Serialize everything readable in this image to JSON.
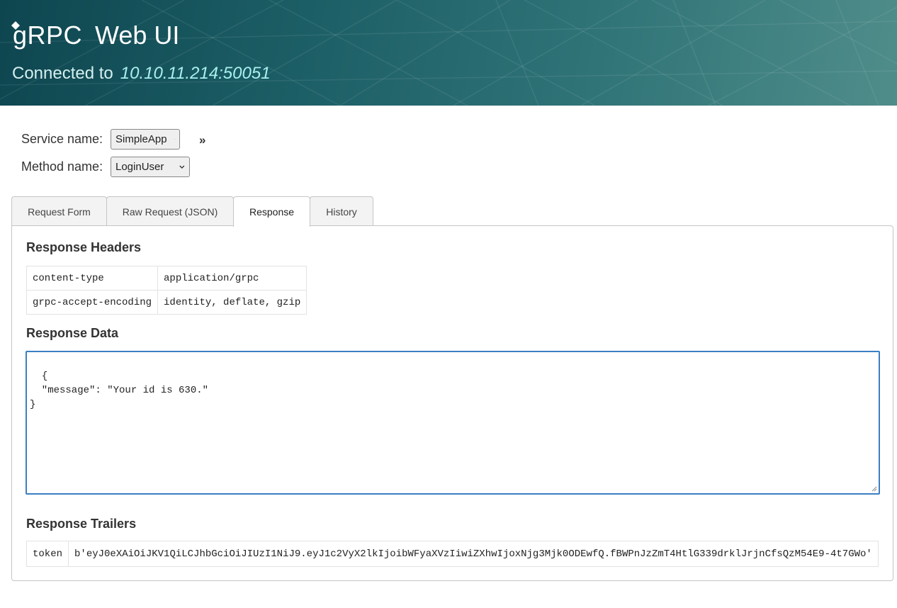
{
  "header": {
    "logo_text": "gRPC",
    "title": "Web UI",
    "connected_label": "Connected to",
    "address": "10.10.11.214:50051"
  },
  "selectors": {
    "service_label": "Service name:",
    "service_value": "SimpleApp",
    "method_label": "Method name:",
    "method_value": "LoginUser",
    "expand_glyph": "»"
  },
  "tabs": [
    {
      "label": "Request Form",
      "active": false
    },
    {
      "label": "Raw Request (JSON)",
      "active": false
    },
    {
      "label": "Response",
      "active": true
    },
    {
      "label": "History",
      "active": false
    }
  ],
  "response": {
    "headers_title": "Response Headers",
    "headers": [
      {
        "key": "content-type",
        "value": "application/grpc"
      },
      {
        "key": "grpc-accept-encoding",
        "value": "identity, deflate, gzip"
      }
    ],
    "data_title": "Response Data",
    "data_text": "{\n  \"message\": \"Your id is 630.\"\n}",
    "trailers_title": "Response Trailers",
    "trailers": [
      {
        "key": "token",
        "value": "b'eyJ0eXAiOiJKV1QiLCJhbGciOiJIUzI1NiJ9.eyJ1c2VyX2lkIjoibWFyaXVzIiwiZXhwIjoxNjg3Mjk0ODEwfQ.fBWPnJzZmT4HtlG339drklJrjnCfsQzM54E9-4t7GWo'"
      }
    ]
  },
  "colors": {
    "header_start": "#0e4650",
    "header_end": "#4f8d8a",
    "address": "#a8f0ee",
    "textarea_focus": "#3b7fc4"
  },
  "icons": [
    "grpc-logo-diamond-icon",
    "chevron-down-icon",
    "resize-grip-icon"
  ]
}
